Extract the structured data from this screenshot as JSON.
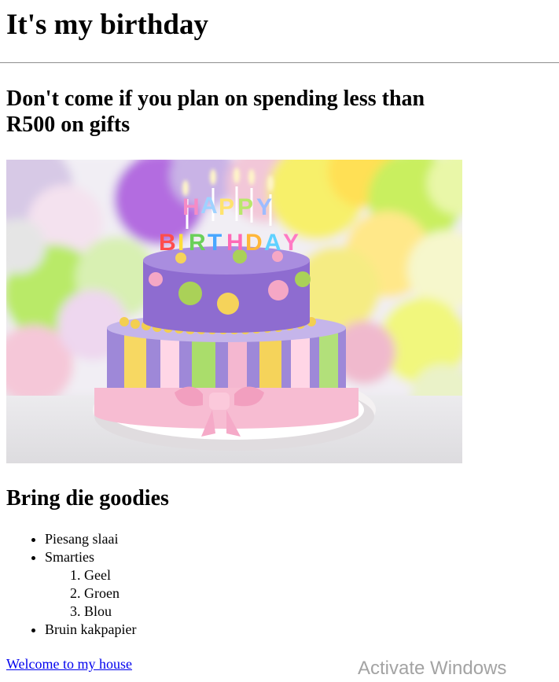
{
  "header": {
    "title": "It's my birthday"
  },
  "notice": {
    "text": "Don't come if you plan on spending less than R500 on gifts"
  },
  "image": {
    "cake_letters_top": "HAPPY",
    "cake_letters_bottom": "BIRTHDAY"
  },
  "goodies": {
    "heading": "Bring die goodies",
    "items": [
      {
        "label": "Piesang slaai"
      },
      {
        "label": "Smarties",
        "sub_items": [
          "Geel",
          "Groen",
          "Blou"
        ]
      },
      {
        "label": "Bruin kakpapier"
      }
    ]
  },
  "link": {
    "text": "Welcome to my house"
  },
  "os_watermark": {
    "text": "Activate Windows"
  }
}
